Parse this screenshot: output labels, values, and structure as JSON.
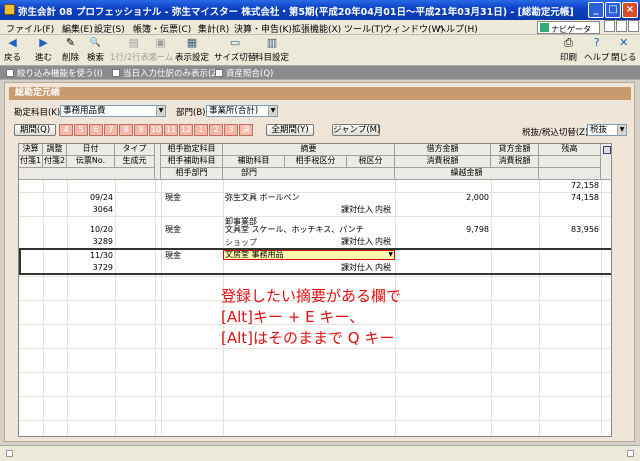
{
  "window": {
    "title": "弥生会計 08 プロフェッショナル - 弥生マイスター 株式会社・第5期(平成20年04月01日～平成21年03月31日) - [総勘定元帳]",
    "controls": [
      "_",
      "□",
      "×"
    ]
  },
  "menu": {
    "items": [
      "ファイル(F)",
      "編集(E)",
      "設定(S)",
      "帳簿・伝票(C)",
      "集計(R)",
      "決算・申告(K)",
      "拡張機能(X)",
      "ツール(T)",
      "ウィンドウ(W)",
      "ヘルプ(H)"
    ],
    "navi": "ナビゲータ"
  },
  "toolbar": {
    "left": [
      {
        "icon": "back-icon",
        "glyph": "◀",
        "label": "戻る"
      },
      {
        "icon": "forward-icon",
        "glyph": "▶",
        "label": "進む"
      },
      {
        "icon": "delete-icon",
        "glyph": "✎",
        "label": "削除"
      },
      {
        "icon": "search-icon",
        "glyph": "🔍",
        "label": "検索"
      },
      {
        "icon": "line-display-icon",
        "glyph": "▤",
        "label": "1行/2行表示"
      },
      {
        "icon": "zoom-icon",
        "glyph": "▣",
        "label": "ズーム"
      },
      {
        "icon": "display-settings-icon",
        "glyph": "▦",
        "label": "表示設定"
      },
      {
        "icon": "size-toggle-icon",
        "glyph": "▭",
        "label": "サイズ切替"
      },
      {
        "icon": "account-settings-icon",
        "glyph": "▥",
        "label": "科目設定"
      }
    ],
    "right": [
      {
        "icon": "print-icon",
        "glyph": "⎙",
        "label": "印刷"
      },
      {
        "icon": "help-icon",
        "glyph": "?",
        "label": "ヘルプ"
      },
      {
        "icon": "close-icon",
        "glyph": "✕",
        "label": "閉じる"
      }
    ]
  },
  "subbar": [
    "絞り込み機能を使う(I)",
    "当日入力仕訳のみ表示(Z)",
    "資産照合(Q)"
  ],
  "panel": {
    "title": "総勘定元帳",
    "account_label": "勘定科目(K)",
    "account_value": "事務用品費",
    "dept_label": "部門(B)",
    "dept_value": "事業所(合計)",
    "period_button": "期間(Q)",
    "months": [
      "4",
      "5",
      "6",
      "7",
      "8",
      "9",
      "10",
      "11",
      "12",
      "1",
      "2",
      "3",
      "決"
    ],
    "all_period_button": "全期間(Y)",
    "jump_button": "ジャンプ(M)",
    "tax_label": "税抜/税込切替(Z)",
    "tax_value": "税抜"
  },
  "table": {
    "headers_row1": [
      "決算",
      "調整",
      "日付",
      "タイプ",
      "相手勘定科目",
      "摘要",
      "借方金額",
      "貸方金額",
      "残高"
    ],
    "headers_row2": [
      "付箋1",
      "付箋2",
      "伝票No.",
      "生成元",
      "相手補助科目",
      "補助科目",
      "相手税区分",
      "税区分",
      "消費税額",
      "消費税額"
    ],
    "headers_row3": [
      "相手部門",
      "部門",
      "繰越金額"
    ],
    "opening_balance": "72,158",
    "rows": [
      {
        "date": "09/24",
        "no": "3064",
        "counter": "現金",
        "desc": "弥生文具 ボールペン",
        "tax": "課対仕入",
        "taxin": "内税",
        "debit": "2,000",
        "balance": "74,158",
        "dept": "卸事業部"
      },
      {
        "date": "10/20",
        "no": "3289",
        "counter": "現金",
        "desc": "文具堂 スケール、ホッチキス、パンチ",
        "tax": "課対仕入",
        "taxin": "内税",
        "debit": "9,798",
        "balance": "83,956",
        "dept": "ショップ"
      },
      {
        "date": "11/30",
        "no": "3729",
        "counter": "現金",
        "desc": "文房堂 事務用品",
        "tax": "課対仕入",
        "taxin": "内税",
        "debit": "",
        "balance": "",
        "dept": ""
      }
    ]
  },
  "annotation": [
    "登録したい摘要がある欄で",
    "[Alt]キー + E キー、",
    "[Alt]はそのままで Q キー"
  ]
}
